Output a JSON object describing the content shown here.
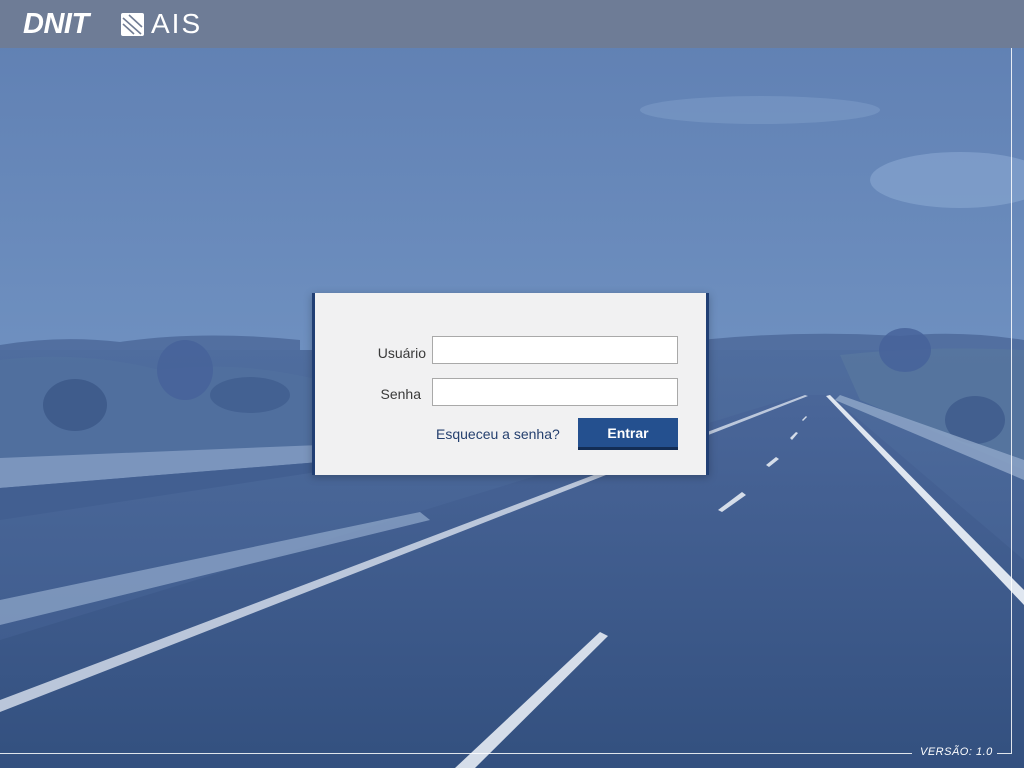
{
  "header": {
    "brand_primary": "DNIT",
    "brand_secondary": "AIS"
  },
  "login": {
    "username_label": "Usuário",
    "username_value": "",
    "password_label": "Senha",
    "password_value": "",
    "forgot_password_link": "Esqueceu a senha?",
    "submit_label": "Entrar"
  },
  "footer": {
    "version": "VERSÃO: 1.0"
  },
  "colors": {
    "topbar": "#707c94",
    "background_tint": "#3f5f92",
    "card_background": "#f1f1f2",
    "card_border": "#213f74",
    "button": "#24508f",
    "link": "#25406f"
  },
  "icons": {
    "brand_mark": "ais-logo-mark-icon"
  }
}
